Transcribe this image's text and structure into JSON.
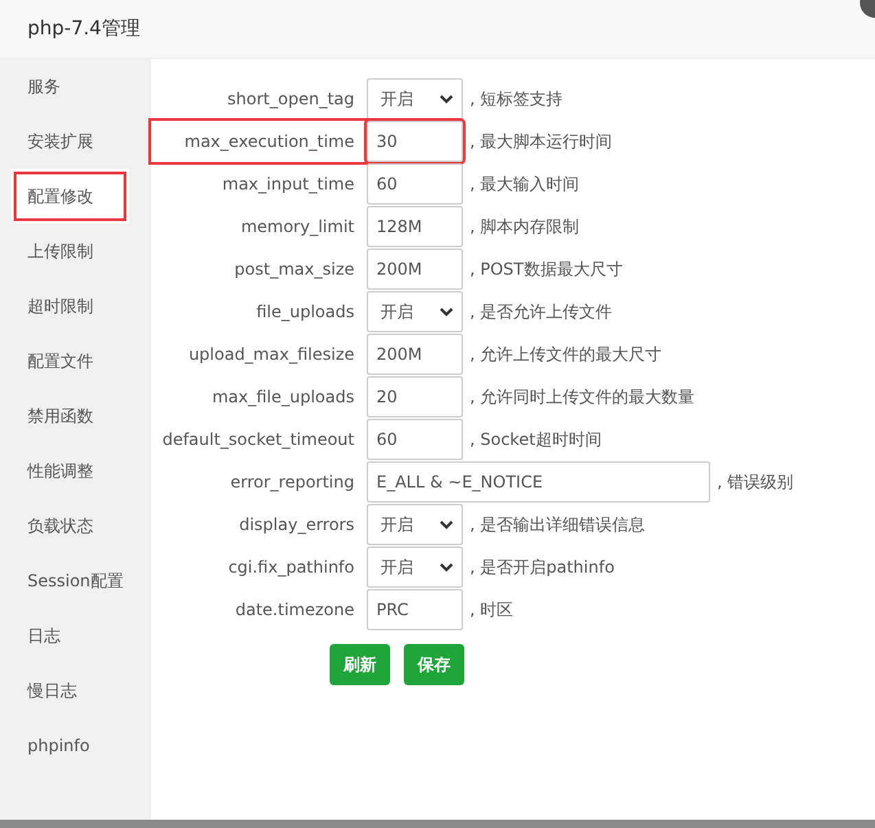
{
  "window": {
    "title": "php-7.4管理"
  },
  "sidebar": {
    "items": [
      {
        "label": "服务",
        "selected": false,
        "highlighted": false
      },
      {
        "label": "安装扩展",
        "selected": false,
        "highlighted": false
      },
      {
        "label": "配置修改",
        "selected": true,
        "highlighted": true
      },
      {
        "label": "上传限制",
        "selected": false,
        "highlighted": false
      },
      {
        "label": "超时限制",
        "selected": false,
        "highlighted": false
      },
      {
        "label": "配置文件",
        "selected": false,
        "highlighted": false
      },
      {
        "label": "禁用函数",
        "selected": false,
        "highlighted": false
      },
      {
        "label": "性能调整",
        "selected": false,
        "highlighted": false
      },
      {
        "label": "负载状态",
        "selected": false,
        "highlighted": false
      },
      {
        "label": "Session配置",
        "selected": false,
        "highlighted": false
      },
      {
        "label": "日志",
        "selected": false,
        "highlighted": false
      },
      {
        "label": "慢日志",
        "selected": false,
        "highlighted": false
      },
      {
        "label": "phpinfo",
        "selected": false,
        "highlighted": false
      }
    ]
  },
  "settings": [
    {
      "name": "short_open_tag",
      "kind": "select",
      "value": "开启",
      "hint": ", 短标签支持",
      "highlighted": false
    },
    {
      "name": "max_execution_time",
      "kind": "input",
      "value": "30",
      "hint": ", 最大脚本运行时间",
      "highlighted": true
    },
    {
      "name": "max_input_time",
      "kind": "input",
      "value": "60",
      "hint": ", 最大输入时间",
      "highlighted": false
    },
    {
      "name": "memory_limit",
      "kind": "input",
      "value": "128M",
      "hint": ", 脚本内存限制",
      "highlighted": false
    },
    {
      "name": "post_max_size",
      "kind": "input",
      "value": "200M",
      "hint": ", POST数据最大尺寸",
      "highlighted": false
    },
    {
      "name": "file_uploads",
      "kind": "select",
      "value": "开启",
      "hint": ", 是否允许上传文件",
      "highlighted": false
    },
    {
      "name": "upload_max_filesize",
      "kind": "input",
      "value": "200M",
      "hint": ", 允许上传文件的最大尺寸",
      "highlighted": false
    },
    {
      "name": "max_file_uploads",
      "kind": "input",
      "value": "20",
      "hint": ", 允许同时上传文件的最大数量",
      "highlighted": false
    },
    {
      "name": "default_socket_timeout",
      "kind": "input",
      "value": "60",
      "hint": ", Socket超时时间",
      "highlighted": false
    },
    {
      "name": "error_reporting",
      "kind": "wide",
      "value": "E_ALL & ~E_NOTICE",
      "hint": ", 错误级别",
      "highlighted": false
    },
    {
      "name": "display_errors",
      "kind": "select",
      "value": "开启",
      "hint": ", 是否输出详细错误信息",
      "highlighted": false
    },
    {
      "name": "cgi.fix_pathinfo",
      "kind": "select",
      "value": "开启",
      "hint": ", 是否开启pathinfo",
      "highlighted": false
    },
    {
      "name": "date.timezone",
      "kind": "input",
      "value": "PRC",
      "hint": ", 时区",
      "highlighted": false
    }
  ],
  "buttons": [
    "刷新",
    "保存"
  ]
}
